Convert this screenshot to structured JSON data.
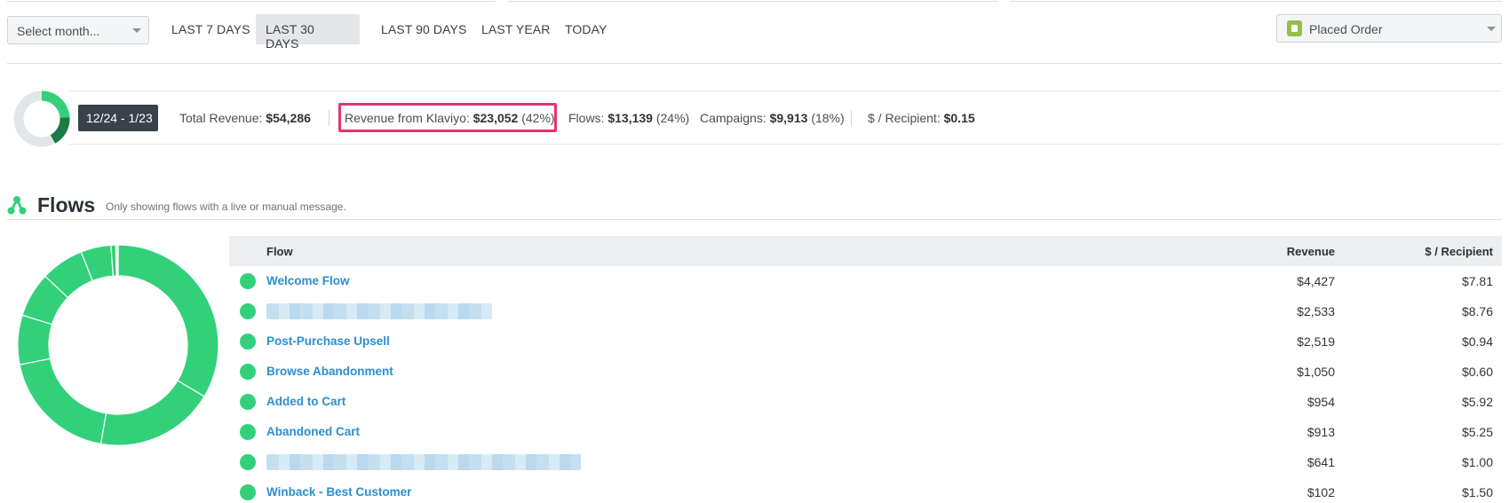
{
  "filter_bar": {
    "month_select_placeholder": "Select month...",
    "ranges": [
      {
        "label": "LAST 7 DAYS",
        "active": false
      },
      {
        "label": "LAST 30 DAYS",
        "active": true
      },
      {
        "label": "LAST 90 DAYS",
        "active": false
      },
      {
        "label": "LAST YEAR",
        "active": false
      },
      {
        "label": "TODAY",
        "active": false
      }
    ],
    "metric_select_value": "Placed Order",
    "metric_icon": "shopify-bag-icon"
  },
  "summary": {
    "date_range": "12/24 - 1/23",
    "total_revenue_label": "Total Revenue:",
    "total_revenue_value": "$54,286",
    "klaviyo_label": "Revenue from Klaviyo:",
    "klaviyo_value": "$23,052",
    "klaviyo_pct": "(42%)",
    "flows_label": "Flows:",
    "flows_value": "$13,139",
    "flows_pct": "(24%)",
    "campaigns_label": "Campaigns:",
    "campaigns_value": "$9,913",
    "campaigns_pct": "(18%)",
    "per_recipient_label": "$ / Recipient:",
    "per_recipient_value": "$0.15",
    "donut_share": {
      "flows": 0.24,
      "campaigns": 0.18
    },
    "colors": {
      "flows": "#33d07a",
      "campaigns": "#1c7a45",
      "rest": "#e3e6e8",
      "highlight": "#e5336f"
    }
  },
  "flows_section": {
    "title": "Flows",
    "subtitle": "Only showing flows with a live or manual message.",
    "icon": "flows-icon",
    "columns": {
      "flow": "Flow",
      "revenue": "Revenue",
      "per_recipient": "$ / Recipient"
    },
    "rows": [
      {
        "name": "Welcome Flow",
        "revenue": "$4,427",
        "per_recipient": "$7.81",
        "redacted": false
      },
      {
        "name": "",
        "revenue": "$2,533",
        "per_recipient": "$8.76",
        "redacted": true
      },
      {
        "name": "Post-Purchase Upsell",
        "revenue": "$2,519",
        "per_recipient": "$0.94",
        "redacted": false
      },
      {
        "name": "Browse Abandonment",
        "revenue": "$1,050",
        "per_recipient": "$0.60",
        "redacted": false
      },
      {
        "name": "Added to Cart",
        "revenue": "$954",
        "per_recipient": "$5.92",
        "redacted": false
      },
      {
        "name": "Abandoned Cart",
        "revenue": "$913",
        "per_recipient": "$5.25",
        "redacted": false
      },
      {
        "name": "",
        "revenue": "$641",
        "per_recipient": "$1.00",
        "redacted": true
      },
      {
        "name": "Winback - Best Customer",
        "revenue": "$102",
        "per_recipient": "$1.50",
        "redacted": false
      }
    ],
    "donut_values": [
      4427,
      2533,
      2519,
      1050,
      954,
      913,
      641,
      102,
      30,
      20
    ],
    "colors": {
      "segment": "#33d07a",
      "status_dot": "#33d07a",
      "link": "#2a8fd0"
    }
  }
}
